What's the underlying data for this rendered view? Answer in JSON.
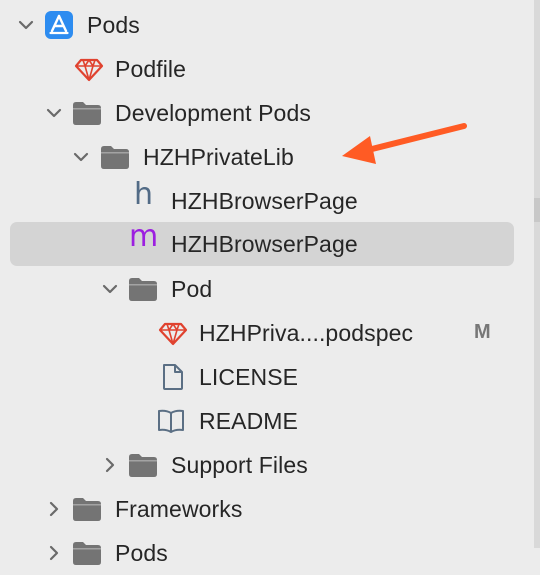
{
  "tree": {
    "pods": {
      "label": "Pods"
    },
    "podfile": {
      "label": "Podfile"
    },
    "development_pods": {
      "label": "Development Pods"
    },
    "hzh_private_lib": {
      "label": "HZHPrivateLib"
    },
    "browser_page_header": {
      "label": "HZHBrowserPage",
      "type_letter": "h"
    },
    "browser_page_impl": {
      "label": "HZHBrowserPage",
      "type_letter": "m"
    },
    "pod_folder": {
      "label": "Pod"
    },
    "podspec": {
      "label": "HZHPriva....podspec",
      "status": "M"
    },
    "license": {
      "label": "LICENSE"
    },
    "readme": {
      "label": "README"
    },
    "support_files": {
      "label": "Support Files"
    },
    "frameworks": {
      "label": "Frameworks"
    },
    "pods_group": {
      "label": "Pods"
    }
  },
  "colors": {
    "background": "#ececec",
    "selection": "#d4d4d4",
    "folder": "#747474",
    "ruby": "#e0422f",
    "annotation_arrow": "#ff5b24",
    "header_letter": "#526b86",
    "impl_letter": "#9c1fe0",
    "app_icon": "#2d8cf0"
  },
  "icons": {
    "disclosure": "chevron-icon",
    "project": "app-store-project-icon",
    "podfile": "ruby-gem-icon",
    "folder": "folder-icon",
    "license": "document-icon",
    "readme": "book-icon"
  }
}
